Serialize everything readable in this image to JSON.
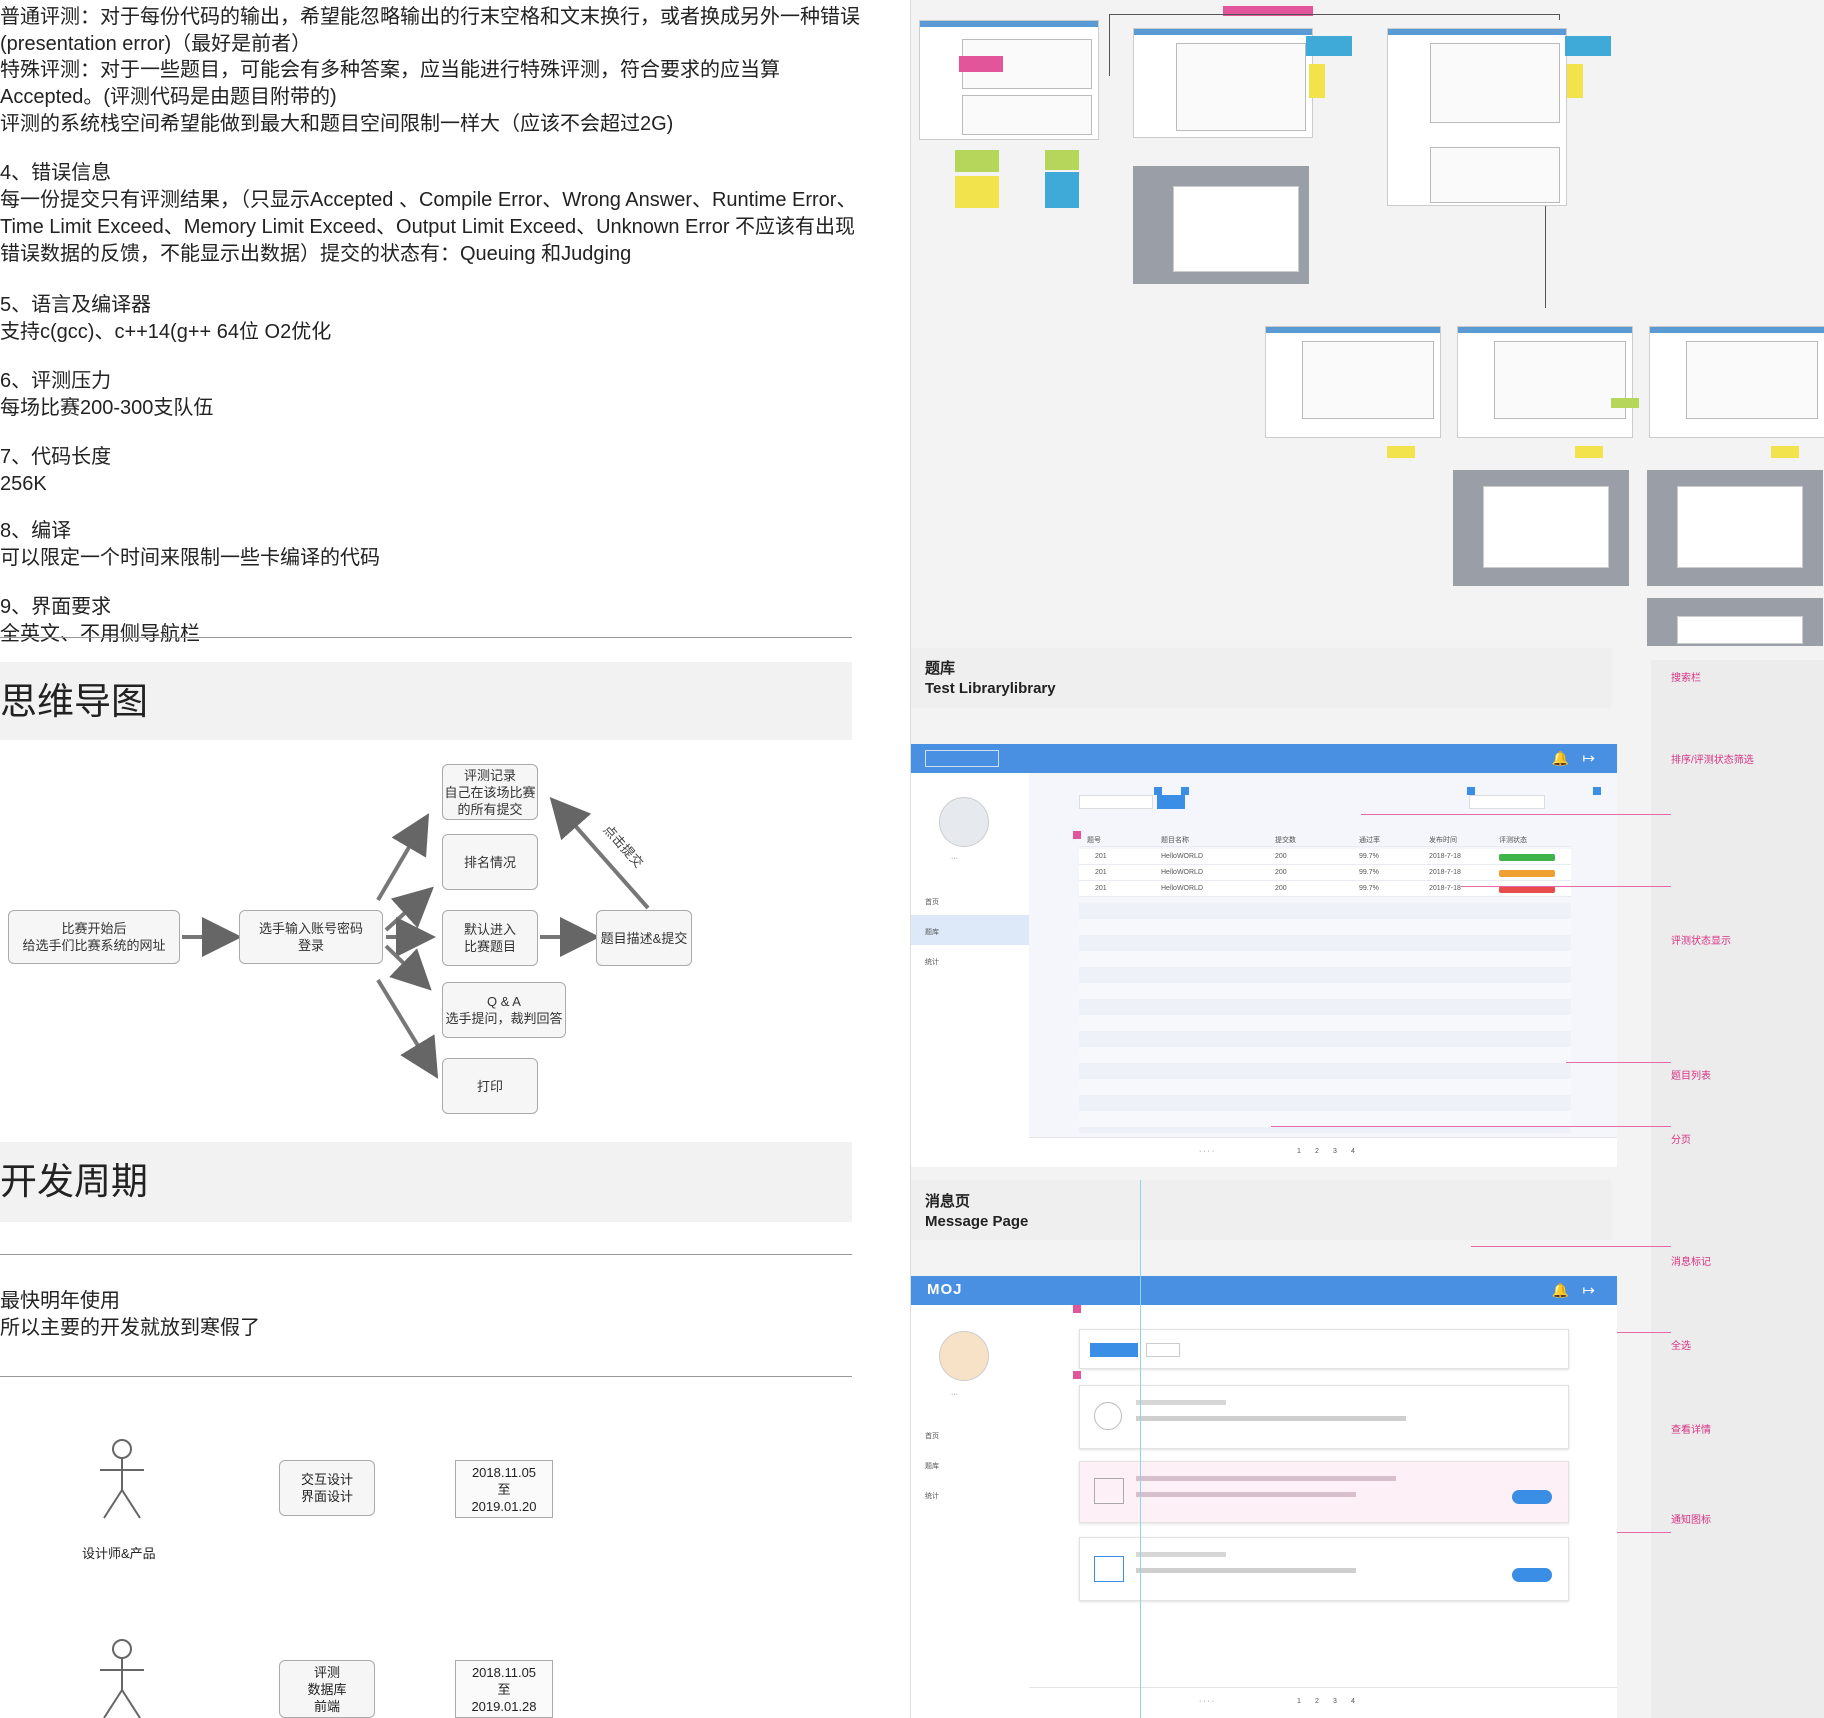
{
  "left": {
    "lines": [
      "普通评测：对于每份代码的输出，希望能忽略输出的行末空格和文末换行，或者换成另外一种错误",
      "(presentation error)（最好是前者）",
      "特殊评测：对于一些题目，可能会有多种答案，应当能进行特殊评测，符合要求的应当算",
      "Accepted。(评测代码是由题目附带的)",
      "评测的系统栈空间希望能做到最大和题目空间限制一样大（应该不会超过2G)",
      "4、错误信息",
      "每一份提交只有评测结果，（只显示Accepted 、Compile Error、Wrong Answer、Runtime Error、",
      "Time Limit Exceed、Memory Limit Exceed、Output Limit Exceed、Unknown Error 不应该有出现",
      "错误数据的反馈，不能显示出数据）提交的状态有：Queuing 和Judging",
      "5、语言及编译器",
      "支持c(gcc)、c++14(g++ 64位 O2优化",
      "6、评测压力",
      "每场比赛200-300支队伍",
      "7、代码长度",
      "256K",
      "8、编译",
      "可以限定一个时间来限制一些卡编译的代码",
      "9、界面要求",
      "全英文、不用侧导航栏"
    ],
    "heading_mindmap": "思维导图",
    "heading_cycle": "开发周期",
    "mindmap": {
      "n1": [
        "比赛开始后",
        "给选手们比赛系统的网址"
      ],
      "n2": [
        "选手输入账号密码",
        "登录"
      ],
      "n3": [
        "评测记录",
        "自己在该场比赛",
        "的所有提交"
      ],
      "n4": [
        "排名情况"
      ],
      "n5": [
        "默认进入",
        "比赛题目"
      ],
      "n6": [
        "Q & A",
        "选手提问，裁判回答"
      ],
      "n7": [
        "打印"
      ],
      "n8": [
        "题目描述&提交"
      ],
      "edge_label": "点击提交"
    },
    "cycle_text": [
      "最快明年使用",
      "所以主要的开发就放到寒假了"
    ],
    "roles": [
      {
        "actor": "设计师&产品",
        "task": [
          "交互设计",
          "界面设计"
        ],
        "date": [
          "2018.11.05",
          "至",
          "2019.01.20"
        ]
      },
      {
        "actor": "",
        "task": [
          "评测",
          "数据库",
          "前端"
        ],
        "date": [
          "2018.11.05",
          "至",
          "2019.01.28"
        ]
      }
    ]
  },
  "right": {
    "library_title_cn": "题库",
    "library_title_en": "Test Librarylibrary",
    "message_title_cn": "消息页",
    "message_title_en": "Message Page",
    "logo": "MOJ",
    "table_headers": [
      "题号",
      "题目名称",
      "提交数",
      "通过率",
      "发布时间",
      "评测状态"
    ],
    "table_rows": [
      [
        "201",
        "HelloWORLD",
        "200",
        "99.7%",
        "2018-7-18"
      ],
      [
        "201",
        "HelloWORLD",
        "200",
        "99.7%",
        "2018-7-18"
      ],
      [
        "201",
        "HelloWORLD",
        "200",
        "99.7%",
        "2018-7-18"
      ]
    ],
    "status_colors": [
      "#3fb44a",
      "#f0a032",
      "#e84b4b"
    ],
    "nav": [
      "首页",
      "题库",
      "统计"
    ],
    "annotations": [
      "搜索栏",
      "排序/评测状态筛选",
      "评测状态显示",
      "题目列表",
      "分页",
      "消息标记",
      "全选",
      "查看详情",
      "通知图标"
    ],
    "accent": "#4a90e2",
    "anno_color": "#e3559b"
  }
}
